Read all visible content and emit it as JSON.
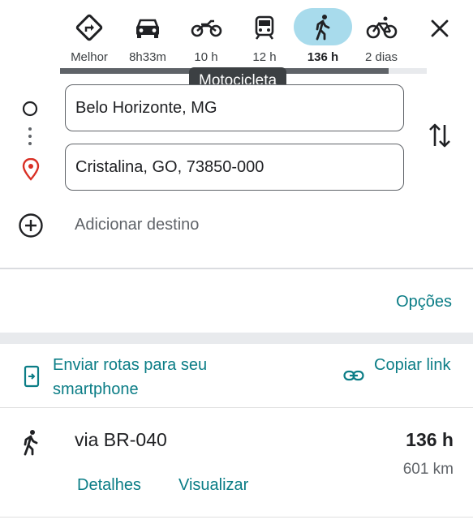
{
  "travel_modes": [
    {
      "name": "Melhor",
      "icon": "best-route-icon"
    },
    {
      "name": "8h33m",
      "icon": "car-icon"
    },
    {
      "name": "10 h",
      "icon": "motorcycle-icon"
    },
    {
      "name": "12 h",
      "icon": "transit-icon"
    },
    {
      "name": "136 h",
      "icon": "walk-icon",
      "selected": true
    },
    {
      "name": "2 dias",
      "icon": "bicycle-icon"
    }
  ],
  "tooltip": "Motocicleta",
  "origin": "Belo Horizonte, MG",
  "destination": "Cristalina, GO, 73850-000",
  "add_destination": "Adicionar destino",
  "options_label": "Opções",
  "send_to_phone": "Enviar rotas para seu smartphone",
  "copy_link": "Copiar link",
  "route": {
    "title": "via BR-040",
    "time": "136 h",
    "distance": "601 km",
    "details_label": "Detalhes",
    "view_label": "Visualizar"
  },
  "colors": {
    "accent": "#0b7d86",
    "selected_mode_bg": "#a8dbec",
    "destination_pin": "#d93025"
  }
}
